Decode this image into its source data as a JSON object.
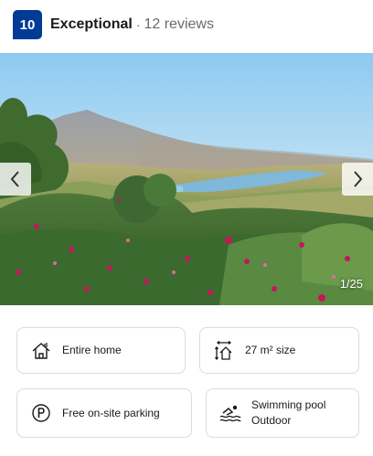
{
  "rating": {
    "score": "10",
    "label": "Exceptional",
    "separator": "·",
    "reviews": "12 reviews"
  },
  "gallery": {
    "counter": "1/25",
    "prev_icon": "chevron-left-icon",
    "next_icon": "chevron-right-icon"
  },
  "features": [
    {
      "icon": "house-icon",
      "label": "Entire home"
    },
    {
      "icon": "size-icon",
      "label": "27 m² size"
    },
    {
      "icon": "parking-icon",
      "label": "Free on-site parking"
    },
    {
      "icon": "swimming-pool-icon",
      "label": "Swimming pool",
      "sublabel": "Outdoor"
    }
  ],
  "colors": {
    "badge": "#003b95",
    "border": "#dcdcdc"
  }
}
